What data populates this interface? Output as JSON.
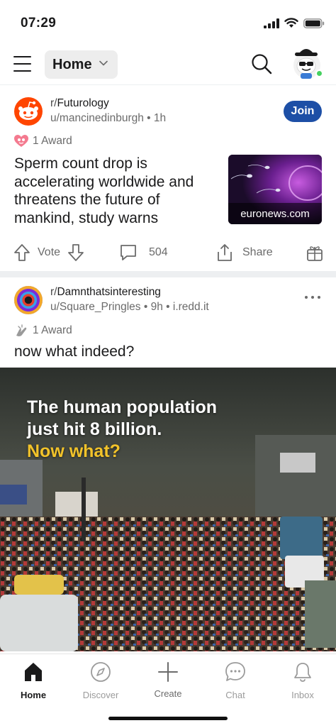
{
  "status_bar": {
    "time": "07:29"
  },
  "header": {
    "feed_label": "Home"
  },
  "posts": [
    {
      "subreddit": "Futurology",
      "subreddit_prefix": "r/",
      "user": "u/mancinedinburgh",
      "age": "1h",
      "join_label": "Join",
      "award_text": "1 Award",
      "title_lines": [
        "Sperm count drop is",
        "accelerating worldwide and",
        "threatens the future of",
        "mankind, study warns"
      ],
      "thumbnail_domain": "euronews.com",
      "vote_label": "Vote",
      "comment_count": "504",
      "share_label": "Share"
    },
    {
      "subreddit": "Damnthatsinteresting",
      "subreddit_prefix": "r/",
      "user": "u/Square_Pringles",
      "age": "9h",
      "domain": "i.redd.it",
      "award_text": "1 Award",
      "title": "now what indeed?",
      "media_text_lines": [
        "The human population",
        "just hit 8 billion.",
        "Now what?"
      ]
    }
  ],
  "bottom_nav": [
    {
      "label": "Home",
      "icon": "home-icon",
      "active": true
    },
    {
      "label": "Discover",
      "icon": "compass-icon",
      "active": false
    },
    {
      "label": "Create",
      "icon": "plus-icon",
      "active": false
    },
    {
      "label": "Chat",
      "icon": "chat-bubble-icon",
      "active": false
    },
    {
      "label": "Inbox",
      "icon": "bell-icon",
      "active": false
    }
  ],
  "colors": {
    "join_button": "#1d4fa6",
    "brand_orange": "#ff4500",
    "online_dot": "#46d160",
    "media_highlight": "#f2c32a"
  }
}
